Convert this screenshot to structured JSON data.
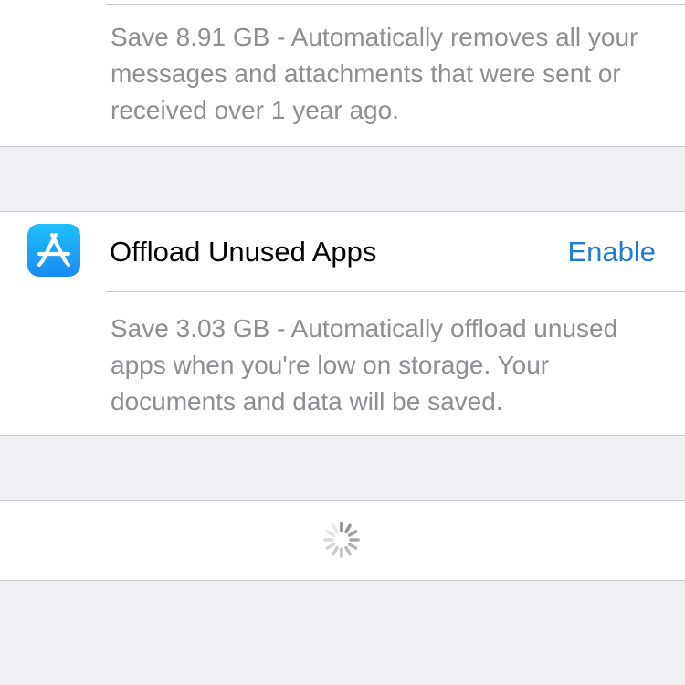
{
  "messages_card": {
    "description": "Save 8.91 GB - Automatically removes all your messages and attachments that were sent or received over 1 year ago."
  },
  "offload_card": {
    "icon": "app-store-icon",
    "title": "Offload Unused Apps",
    "action_label": "Enable",
    "description": "Save 3.03 GB - Automatically offload unused apps when you're low on storage. Your documents and data will be saved."
  },
  "loading_card": {
    "icon": "activity-spinner-icon"
  },
  "colors": {
    "background": "#efeff4",
    "card": "#ffffff",
    "separator": "#c8c7cc",
    "secondary_text": "#8e8e93",
    "primary_text": "#000000",
    "accent": "#1f7ad9",
    "app_icon_top": "#1ec0fb",
    "app_icon_bottom": "#1a8af5"
  }
}
